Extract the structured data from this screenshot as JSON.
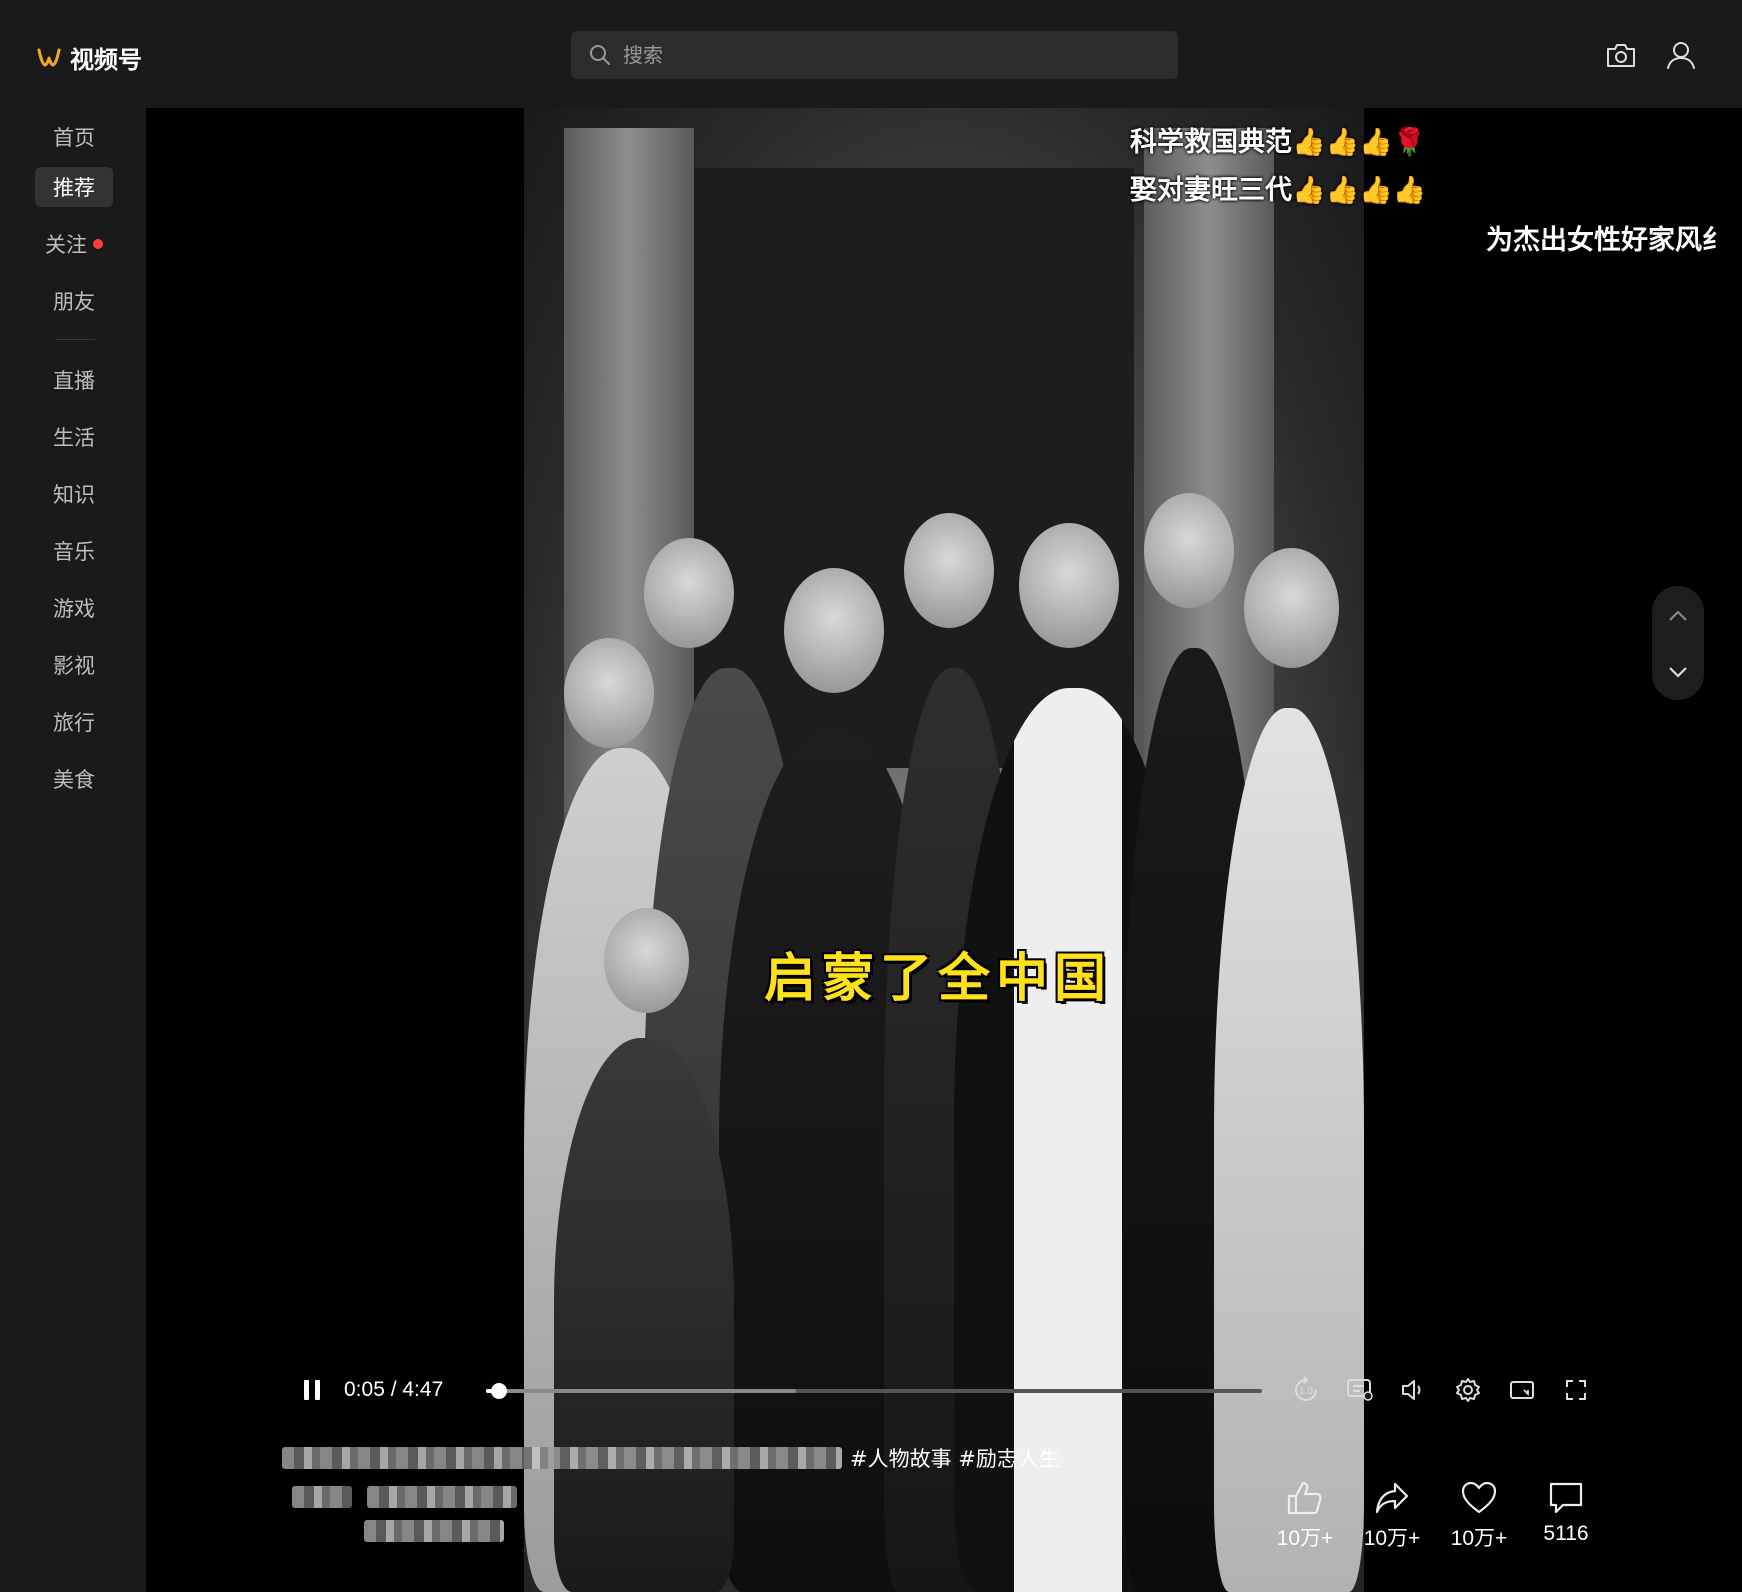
{
  "app": {
    "name": "视频号",
    "brand_color": "#f5a623"
  },
  "search": {
    "placeholder": "搜索"
  },
  "header_icons": [
    "camera-icon",
    "user-icon"
  ],
  "sidebar": {
    "items": [
      {
        "label": "首页",
        "active": false
      },
      {
        "label": "推荐",
        "active": true
      },
      {
        "label": "关注",
        "active": false,
        "has_dot": true
      },
      {
        "label": "朋友",
        "active": false
      },
      {
        "label": "直播",
        "active": false
      },
      {
        "label": "生活",
        "active": false
      },
      {
        "label": "知识",
        "active": false
      },
      {
        "label": "音乐",
        "active": false
      },
      {
        "label": "游戏",
        "active": false
      },
      {
        "label": "影视",
        "active": false
      },
      {
        "label": "旅行",
        "active": false
      },
      {
        "label": "美食",
        "active": false
      }
    ]
  },
  "video": {
    "overlay_line_1": "科学救国典范👍👍👍🌹",
    "overlay_line_2": "娶对妻旺三代👍👍👍👍",
    "scrolling_caption": "为杰出女性好家风纟",
    "subtitle": "启蒙了全中国"
  },
  "player": {
    "time": "0:05 / 4:47",
    "progress_fraction": 0.017,
    "buffer_fraction": 0.4,
    "state": "playing"
  },
  "description": {
    "hashtags": "#人物故事 #励志人生"
  },
  "actions": [
    {
      "name": "like",
      "label": "10万+"
    },
    {
      "name": "share",
      "label": "10万+"
    },
    {
      "name": "favorite",
      "label": "10万+"
    },
    {
      "name": "comment",
      "label": "5116"
    }
  ]
}
